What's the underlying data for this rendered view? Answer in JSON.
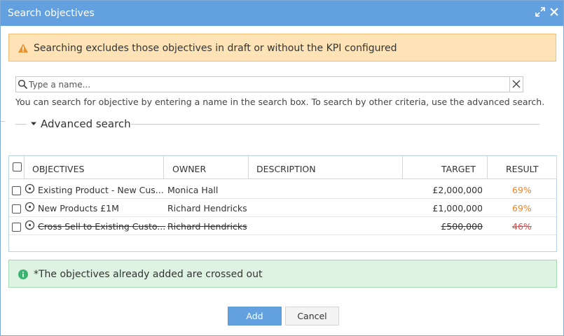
{
  "dialog": {
    "title": "Search objectives"
  },
  "warning": {
    "text": "Searching excludes those objectives in draft or without the KPI configured"
  },
  "search": {
    "placeholder": "Type a name...",
    "value": "",
    "hint": "You can search for objective by entering a name in the search box. To search by other criteria, use the advanced search."
  },
  "advanced_search": {
    "label": "Advanced search"
  },
  "table": {
    "columns": {
      "objectives": "OBJECTIVES",
      "owner": "OWNER",
      "description": "DESCRIPTION",
      "target": "TARGET",
      "result": "RESULT"
    },
    "rows": [
      {
        "objective": "Existing Product - New Cus...",
        "owner": "Monica Hall",
        "description": "",
        "target": "£2,000,000",
        "result": "69%",
        "result_color": "#e8892c",
        "crossed_out": false
      },
      {
        "objective": "New Products £1M",
        "owner": "Richard Hendricks",
        "description": "",
        "target": "£1,000,000",
        "result": "69%",
        "result_color": "#e8892c",
        "crossed_out": false
      },
      {
        "objective": "Cross Sell to Existing Custo...",
        "owner": "Richard Hendricks",
        "description": "",
        "target": "£500,000",
        "result": "46%",
        "result_color": "#e04b4b",
        "crossed_out": true
      }
    ]
  },
  "info": {
    "text": "*The objectives already added are crossed out"
  },
  "buttons": {
    "add": "Add",
    "cancel": "Cancel"
  },
  "colors": {
    "titlebar": "#62a0df",
    "warning_bg": "#fde3b6",
    "info_bg": "#dff3e3",
    "accent": "#62a0df"
  }
}
